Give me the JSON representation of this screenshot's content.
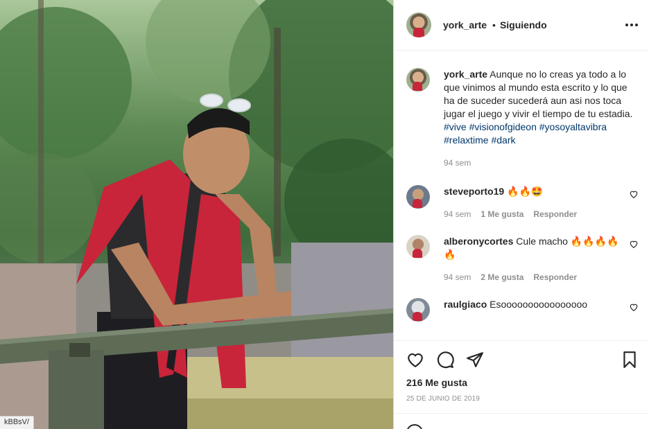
{
  "photo": {
    "url_fragment": "kBBsV/"
  },
  "header": {
    "username": "york_arte",
    "separator": "•",
    "follow_status": "Siguiendo"
  },
  "caption": {
    "username": "york_arte",
    "text": "Aunque no lo creas ya todo a lo que vinimos al mundo esta escrito y lo que ha de suceder sucederá aun asi nos toca jugar el juego y vivir el tiempo de tu estadia.",
    "hashtags": [
      "#vive",
      "#visionofgideon",
      "#yosoyaltavibra",
      "#relaxtime",
      "#dark"
    ],
    "time": "94 sem"
  },
  "comments": [
    {
      "username": "steveporto19",
      "text": "🔥🔥🤩",
      "time": "94 sem",
      "likes": "1 Me gusta",
      "reply": "Responder"
    },
    {
      "username": "alberonycortes",
      "text": "Cule macho 🔥🔥🔥🔥🔥",
      "time": "94 sem",
      "likes": "2 Me gusta",
      "reply": "Responder"
    },
    {
      "username": "raulgiaco",
      "text": "Esoooooooooooooooo",
      "time": "",
      "likes": "",
      "reply": ""
    }
  ],
  "actions": {
    "likes_count": "216 Me gusta",
    "date": "25 DE JUNIO DE 2019"
  },
  "colors": {
    "hashtag": "#00376b",
    "muted": "#8e8e8e",
    "text": "#262626",
    "hoodie": "#c8253a"
  }
}
